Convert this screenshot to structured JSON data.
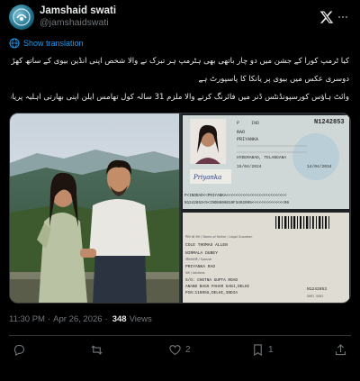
{
  "header": {
    "display_name": "Jamshaid swati",
    "handle": "@jamshaidswati"
  },
  "translate": {
    "label": "Show translation"
  },
  "body": {
    "lines": [
      "کیا ٹرمپ کورا کے جشن میں دو چار باتھی بھی ہٹرمپ ہر تبرک نے والا شخص اپنی انڈین بیوی کے ساتھ کھڑا ہے اس عکس میں اور",
      "دوسری عکس میں بیوی پر یانکا کا پاسپورٹ ہے",
      "وائٹ ہاؤس کورسپونڈنٹس ڈنر میں فائرنگ کرنے والا ملزم 31 سالہ کول تھامس ایلن اپنی بھارتی اہلیہ پریانکا راؤ کے ساتھ"
    ]
  },
  "passport": {
    "number": "N1242853",
    "type_code": "P",
    "country_code": "IND",
    "surname": "RAO",
    "given_name": "PRIYANKA",
    "birth_place": "HYDERABAD, TELANGANA",
    "issue_date": "15/04/2024",
    "expiry_date": "14/04/2034",
    "signature": "Priyanka",
    "mrz_line1": "P<INDRAO<<PRIYANKA<<<<<<<<<<<<<<<<<<<<<<<<<<",
    "mrz_line2": "N1242853<5<IND8606010F3402095<<<<<<<<<<<<<<06",
    "back_header": "पिता का नाम / Name of Father / Legal Guardian",
    "father": "COLE THOMAS ALLEN",
    "spouse_label": "जीवनसाथी / Spouse",
    "mother": "NIRMALA DUBEY",
    "spouse": "PRIYANKA RAO",
    "address_label": "पता / Address",
    "address1": "S/O: CHETNA GUPTA ROAD",
    "address2": "ANAND BAGH PAHAR GANJ,DELHI",
    "address3": "PIN:110055,DELHI,INDIA",
    "back_number": "N1242853",
    "back_small": "SHRI SONI"
  },
  "meta": {
    "time": "11:30 PM",
    "separator": "·",
    "date": "Apr 26, 2026",
    "views_count": "348",
    "views_label": "Views"
  },
  "actions": {
    "reply_count": "",
    "retweet_count": "",
    "like_count": "2",
    "bookmark_count": "1"
  },
  "colors": {
    "background": "#000000",
    "text": "#e7e9ea",
    "muted": "#71767b",
    "accent": "#1d9bf0",
    "border": "#2f3336"
  }
}
